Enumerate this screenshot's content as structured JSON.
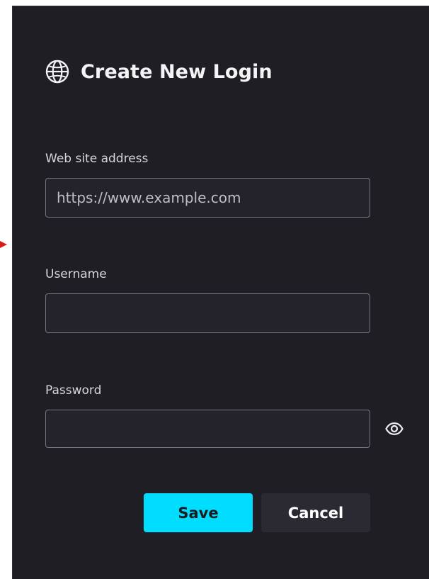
{
  "dialog": {
    "title": "Create New Login",
    "icon": "globe-icon",
    "accent_color": "#00ddff",
    "background_color": "#1f1e24"
  },
  "fields": {
    "website": {
      "label": "Web site address",
      "placeholder": "https://www.example.com",
      "value": ""
    },
    "username": {
      "label": "Username",
      "placeholder": "",
      "value": ""
    },
    "password": {
      "label": "Password",
      "placeholder": "",
      "value": "",
      "toggle_icon": "eye-icon"
    }
  },
  "actions": {
    "save_label": "Save",
    "cancel_label": "Cancel"
  }
}
